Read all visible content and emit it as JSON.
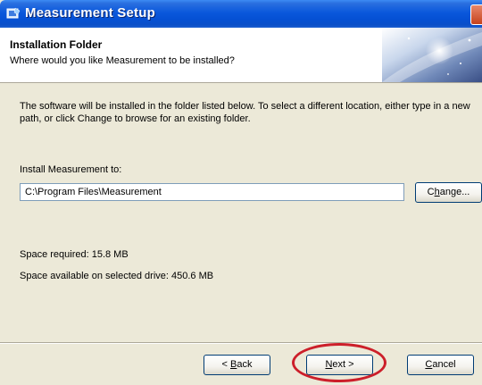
{
  "window": {
    "title": "Measurement Setup",
    "icon": "setup-icon",
    "close_icon": "close-icon"
  },
  "header": {
    "title": "Installation Folder",
    "subtitle": "Where would you like Measurement to be installed?"
  },
  "body": {
    "intro": "The software will be installed in the folder listed below. To select a different location, either type in a new path, or click Change to browse for an existing folder.",
    "install_label": "Install Measurement to:",
    "install_path": "C:\\Program Files\\Measurement",
    "change_button": {
      "before": "C",
      "accel": "h",
      "after": "ange..."
    },
    "space_required": "Space required: 15.8 MB",
    "space_available": "Space available on selected drive: 450.6 MB"
  },
  "footer": {
    "back_button": {
      "before": "< ",
      "accel": "B",
      "after": "ack"
    },
    "next_button": {
      "before": "",
      "accel": "N",
      "after": "ext >"
    },
    "cancel_button": {
      "before": "",
      "accel": "C",
      "after": "ancel"
    }
  },
  "colors": {
    "title_bar": "#0a58dc",
    "dialog_bg": "#ece9d8",
    "highlight_ring": "#cc1f2a"
  }
}
